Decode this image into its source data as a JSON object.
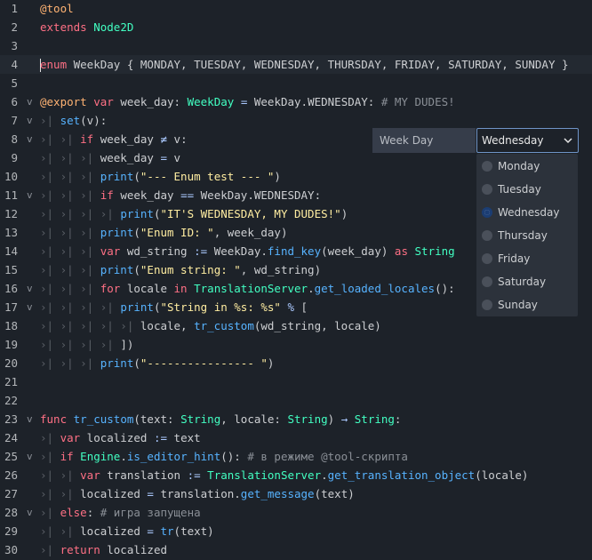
{
  "lines": [
    {
      "n": "1",
      "fold": "",
      "tokens": [
        [
          "an",
          "@tool"
        ]
      ]
    },
    {
      "n": "2",
      "fold": "",
      "tokens": [
        [
          "kw",
          "extends"
        ],
        [
          "tx",
          " "
        ],
        [
          "ty",
          "Node2D"
        ]
      ]
    },
    {
      "n": "3",
      "fold": "",
      "tokens": []
    },
    {
      "n": "4",
      "fold": "",
      "current": true,
      "caret": true,
      "tokens": [
        [
          "kw",
          "enum"
        ],
        [
          "tx",
          " WeekDay { MONDAY, TUESDAY, WEDNESDAY, THURSDAY, FRIDAY, SATURDAY, SUNDAY }"
        ]
      ]
    },
    {
      "n": "5",
      "fold": "",
      "tokens": []
    },
    {
      "n": "6",
      "fold": "v",
      "tokens": [
        [
          "an",
          "@export"
        ],
        [
          "tx",
          " "
        ],
        [
          "kw",
          "var"
        ],
        [
          "tx",
          " week_day: "
        ],
        [
          "ty",
          "WeekDay"
        ],
        [
          "tx",
          " "
        ],
        [
          "op",
          "="
        ],
        [
          "tx",
          " WeekDay.WEDNESDAY: "
        ],
        [
          "cm",
          "# MY DUDES!"
        ]
      ]
    },
    {
      "n": "7",
      "fold": "v",
      "tokens": [
        [
          "gd",
          "›| "
        ],
        [
          "fn",
          "set"
        ],
        [
          "tx",
          "(v):"
        ]
      ]
    },
    {
      "n": "8",
      "fold": "v",
      "tokens": [
        [
          "gd",
          "›| ›| "
        ],
        [
          "kw",
          "if"
        ],
        [
          "tx",
          " week_day "
        ],
        [
          "op",
          "≠"
        ],
        [
          "tx",
          " v:"
        ]
      ]
    },
    {
      "n": "9",
      "fold": "",
      "tokens": [
        [
          "gd",
          "›| ›| ›| "
        ],
        [
          "tx",
          "week_day "
        ],
        [
          "op",
          "="
        ],
        [
          "tx",
          " v"
        ]
      ]
    },
    {
      "n": "10",
      "fold": "",
      "tokens": [
        [
          "gd",
          "›| ›| ›| "
        ],
        [
          "fn",
          "print"
        ],
        [
          "tx",
          "("
        ],
        [
          "str",
          "\"--- Enum test --- \""
        ],
        [
          "tx",
          ")"
        ]
      ]
    },
    {
      "n": "11",
      "fold": "v",
      "tokens": [
        [
          "gd",
          "›| ›| ›| "
        ],
        [
          "kw",
          "if"
        ],
        [
          "tx",
          " week_day "
        ],
        [
          "op",
          "=="
        ],
        [
          "tx",
          " WeekDay.WEDNESDAY:"
        ]
      ]
    },
    {
      "n": "12",
      "fold": "",
      "tokens": [
        [
          "gd",
          "›| ›| ›| ›| "
        ],
        [
          "fn",
          "print"
        ],
        [
          "tx",
          "("
        ],
        [
          "str",
          "\"IT'S WEDNESDAY, MY DUDES!\""
        ],
        [
          "tx",
          ")"
        ]
      ]
    },
    {
      "n": "13",
      "fold": "",
      "tokens": [
        [
          "gd",
          "›| ›| ›| "
        ],
        [
          "fn",
          "print"
        ],
        [
          "tx",
          "("
        ],
        [
          "str",
          "\"Enum ID: \""
        ],
        [
          "tx",
          ", week_day)"
        ]
      ]
    },
    {
      "n": "14",
      "fold": "",
      "tokens": [
        [
          "gd",
          "›| ›| ›| "
        ],
        [
          "kw",
          "var"
        ],
        [
          "tx",
          " wd_string "
        ],
        [
          "op",
          ":="
        ],
        [
          "tx",
          " WeekDay."
        ],
        [
          "fn",
          "find_key"
        ],
        [
          "tx",
          "(week_day) "
        ],
        [
          "kw",
          "as"
        ],
        [
          "tx",
          " "
        ],
        [
          "ty",
          "String"
        ]
      ]
    },
    {
      "n": "15",
      "fold": "",
      "tokens": [
        [
          "gd",
          "›| ›| ›| "
        ],
        [
          "fn",
          "print"
        ],
        [
          "tx",
          "("
        ],
        [
          "str",
          "\"Enum string: \""
        ],
        [
          "tx",
          ", wd_string)"
        ]
      ]
    },
    {
      "n": "16",
      "fold": "v",
      "tokens": [
        [
          "gd",
          "›| ›| ›| "
        ],
        [
          "kw",
          "for"
        ],
        [
          "tx",
          " locale "
        ],
        [
          "kw",
          "in"
        ],
        [
          "tx",
          " "
        ],
        [
          "ty",
          "TranslationServer"
        ],
        [
          "tx",
          "."
        ],
        [
          "fn",
          "get_loaded_locales"
        ],
        [
          "tx",
          "():"
        ]
      ]
    },
    {
      "n": "17",
      "fold": "v",
      "tokens": [
        [
          "gd",
          "›| ›| ›| ›| "
        ],
        [
          "fn",
          "print"
        ],
        [
          "tx",
          "("
        ],
        [
          "str",
          "\"String in %s: %s\""
        ],
        [
          "tx",
          " "
        ],
        [
          "op",
          "%"
        ],
        [
          "tx",
          " ["
        ]
      ]
    },
    {
      "n": "18",
      "fold": "",
      "tokens": [
        [
          "gd",
          "›| ›| ›| ›| ›| "
        ],
        [
          "tx",
          "locale, "
        ],
        [
          "fn",
          "tr_custom"
        ],
        [
          "tx",
          "(wd_string, locale)"
        ]
      ]
    },
    {
      "n": "19",
      "fold": "",
      "tokens": [
        [
          "gd",
          "›| ›| ›| ›| "
        ],
        [
          "tx",
          "])"
        ]
      ]
    },
    {
      "n": "20",
      "fold": "",
      "tokens": [
        [
          "gd",
          "›| ›| ›| "
        ],
        [
          "fn",
          "print"
        ],
        [
          "tx",
          "("
        ],
        [
          "str",
          "\"---------------- \""
        ],
        [
          "tx",
          ")"
        ]
      ]
    },
    {
      "n": "21",
      "fold": "",
      "tokens": []
    },
    {
      "n": "22",
      "fold": "",
      "tokens": []
    },
    {
      "n": "23",
      "fold": "v",
      "tokens": [
        [
          "kw",
          "func"
        ],
        [
          "tx",
          " "
        ],
        [
          "fn",
          "tr_custom"
        ],
        [
          "tx",
          "(text: "
        ],
        [
          "ty",
          "String"
        ],
        [
          "tx",
          ", locale: "
        ],
        [
          "ty",
          "String"
        ],
        [
          "tx",
          ") "
        ],
        [
          "op",
          "→"
        ],
        [
          "tx",
          " "
        ],
        [
          "ty",
          "String"
        ],
        [
          "tx",
          ":"
        ]
      ]
    },
    {
      "n": "24",
      "fold": "",
      "tokens": [
        [
          "gd",
          "›| "
        ],
        [
          "kw",
          "var"
        ],
        [
          "tx",
          " localized "
        ],
        [
          "op",
          ":="
        ],
        [
          "tx",
          " text"
        ]
      ]
    },
    {
      "n": "25",
      "fold": "v",
      "tokens": [
        [
          "gd",
          "›| "
        ],
        [
          "kw",
          "if"
        ],
        [
          "tx",
          " "
        ],
        [
          "ty",
          "Engine"
        ],
        [
          "tx",
          "."
        ],
        [
          "fn",
          "is_editor_hint"
        ],
        [
          "tx",
          "(): "
        ],
        [
          "cm",
          "# в режиме @tool-скрипта"
        ]
      ]
    },
    {
      "n": "26",
      "fold": "",
      "tokens": [
        [
          "gd",
          "›| ›| "
        ],
        [
          "kw",
          "var"
        ],
        [
          "tx",
          " translation "
        ],
        [
          "op",
          ":="
        ],
        [
          "tx",
          " "
        ],
        [
          "ty",
          "TranslationServer"
        ],
        [
          "tx",
          "."
        ],
        [
          "fn",
          "get_translation_object"
        ],
        [
          "tx",
          "(locale)"
        ]
      ]
    },
    {
      "n": "27",
      "fold": "",
      "tokens": [
        [
          "gd",
          "›| ›| "
        ],
        [
          "tx",
          "localized "
        ],
        [
          "op",
          "="
        ],
        [
          "tx",
          " translation."
        ],
        [
          "fn",
          "get_message"
        ],
        [
          "tx",
          "(text)"
        ]
      ]
    },
    {
      "n": "28",
      "fold": "v",
      "tokens": [
        [
          "gd",
          "›| "
        ],
        [
          "kw",
          "else"
        ],
        [
          "tx",
          ": "
        ],
        [
          "cm",
          "# игра запущена"
        ]
      ]
    },
    {
      "n": "29",
      "fold": "",
      "tokens": [
        [
          "gd",
          "›| ›| "
        ],
        [
          "tx",
          "localized "
        ],
        [
          "op",
          "="
        ],
        [
          "tx",
          " "
        ],
        [
          "fn",
          "tr"
        ],
        [
          "tx",
          "(text)"
        ]
      ]
    },
    {
      "n": "30",
      "fold": "",
      "tokens": [
        [
          "gd",
          "›| "
        ],
        [
          "kw",
          "return"
        ],
        [
          "tx",
          " localized"
        ]
      ]
    }
  ],
  "inspector": {
    "property_label": "Week Day",
    "selected_value": "Wednesday",
    "chevron_icon": "chevron-down-icon"
  },
  "dropdown": {
    "options": [
      "Monday",
      "Tuesday",
      "Wednesday",
      "Thursday",
      "Friday",
      "Saturday",
      "Sunday"
    ],
    "selected": "Wednesday"
  },
  "colors": {
    "background": "#1d2229",
    "keyword": "#ff7085",
    "type": "#42ffc2",
    "function": "#57b3ff",
    "string": "#ffeda1",
    "comment": "#8a8f96",
    "annotation": "#ffb373",
    "accent": "#6f94c7"
  }
}
